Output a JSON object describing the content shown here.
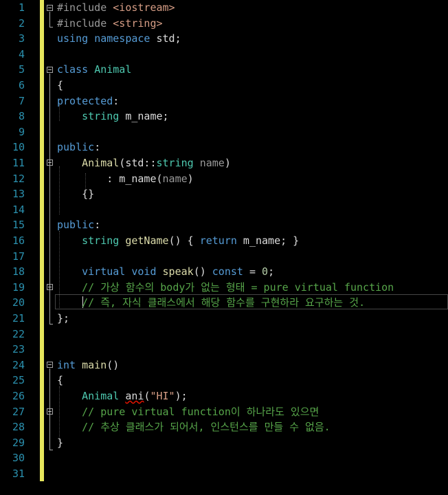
{
  "editor": {
    "line_numbers": [
      "1",
      "2",
      "3",
      "4",
      "5",
      "6",
      "7",
      "8",
      "9",
      "10",
      "11",
      "12",
      "13",
      "14",
      "15",
      "16",
      "17",
      "18",
      "19",
      "20",
      "21",
      "22",
      "23",
      "24",
      "25",
      "26",
      "27",
      "28",
      "29",
      "30",
      "31"
    ],
    "colors": {
      "background": "#000000",
      "line_number": "#2b91af",
      "keyword": "#569cd6",
      "type": "#4ec9b0",
      "function": "#dcdcaa",
      "comment": "#57a64a",
      "string": "#d69d85",
      "change_bar": "#e6e65c"
    },
    "lines": [
      [
        {
          "t": "#include ",
          "c": "pp"
        },
        {
          "t": "<iostream>",
          "c": "inc"
        }
      ],
      [
        {
          "t": "#include ",
          "c": "pp"
        },
        {
          "t": "<string>",
          "c": "inc"
        }
      ],
      [
        {
          "t": "using",
          "c": "kw"
        },
        {
          "t": " ",
          "c": ""
        },
        {
          "t": "namespace",
          "c": "kw"
        },
        {
          "t": " std;",
          "c": ""
        }
      ],
      [],
      [
        {
          "t": "class",
          "c": "kw"
        },
        {
          "t": " ",
          "c": ""
        },
        {
          "t": "Animal",
          "c": "ty"
        }
      ],
      [
        {
          "t": "{",
          "c": ""
        }
      ],
      [
        {
          "t": "protected",
          "c": "kw"
        },
        {
          "t": ":",
          "c": ""
        }
      ],
      [
        {
          "t": "    ",
          "c": ""
        },
        {
          "t": "string",
          "c": "ty"
        },
        {
          "t": " m_name;",
          "c": ""
        }
      ],
      [],
      [
        {
          "t": "public",
          "c": "kw"
        },
        {
          "t": ":",
          "c": ""
        }
      ],
      [
        {
          "t": "    ",
          "c": ""
        },
        {
          "t": "Animal",
          "c": "fn"
        },
        {
          "t": "(std::",
          "c": ""
        },
        {
          "t": "string",
          "c": "ty"
        },
        {
          "t": " ",
          "c": ""
        },
        {
          "t": "name",
          "c": "pm"
        },
        {
          "t": ")",
          "c": ""
        }
      ],
      [
        {
          "t": "        : m_name(",
          "c": ""
        },
        {
          "t": "name",
          "c": "pm"
        },
        {
          "t": ")",
          "c": ""
        }
      ],
      [
        {
          "t": "    {}",
          "c": ""
        }
      ],
      [],
      [
        {
          "t": "public",
          "c": "kw"
        },
        {
          "t": ":",
          "c": ""
        }
      ],
      [
        {
          "t": "    ",
          "c": ""
        },
        {
          "t": "string",
          "c": "ty"
        },
        {
          "t": " ",
          "c": ""
        },
        {
          "t": "getName",
          "c": "fn"
        },
        {
          "t": "() { ",
          "c": ""
        },
        {
          "t": "return",
          "c": "kw"
        },
        {
          "t": " m_name; }",
          "c": ""
        }
      ],
      [],
      [
        {
          "t": "    ",
          "c": ""
        },
        {
          "t": "virtual",
          "c": "kw"
        },
        {
          "t": " ",
          "c": ""
        },
        {
          "t": "void",
          "c": "kw"
        },
        {
          "t": " ",
          "c": ""
        },
        {
          "t": "speak",
          "c": "fn"
        },
        {
          "t": "() ",
          "c": ""
        },
        {
          "t": "const",
          "c": "kw"
        },
        {
          "t": " = ",
          "c": ""
        },
        {
          "t": "0",
          "c": "num"
        },
        {
          "t": ";",
          "c": ""
        }
      ],
      [
        {
          "t": "    ",
          "c": ""
        },
        {
          "t": "// 가상 함수의 body가 없는 형태 = pure virtual function",
          "c": "cm"
        }
      ],
      [
        {
          "t": "    ",
          "c": ""
        },
        {
          "t": "// 즉, 자식 클래스에서 해당 함수를 구현하라 요구하는 것.",
          "c": "cm"
        }
      ],
      [
        {
          "t": "};",
          "c": ""
        }
      ],
      [],
      [],
      [
        {
          "t": "int",
          "c": "kw"
        },
        {
          "t": " ",
          "c": ""
        },
        {
          "t": "main",
          "c": "fn"
        },
        {
          "t": "()",
          "c": ""
        }
      ],
      [
        {
          "t": "{",
          "c": ""
        }
      ],
      [
        {
          "t": "    ",
          "c": ""
        },
        {
          "t": "Animal",
          "c": "ty"
        },
        {
          "t": " ",
          "c": ""
        },
        {
          "t": "ani",
          "c": "sq"
        },
        {
          "t": "(",
          "c": ""
        },
        {
          "t": "\"HI\"",
          "c": "str"
        },
        {
          "t": ");",
          "c": ""
        }
      ],
      [
        {
          "t": "    ",
          "c": ""
        },
        {
          "t": "// pure virtual function이 하나라도 있으면",
          "c": "cm"
        }
      ],
      [
        {
          "t": "    ",
          "c": ""
        },
        {
          "t": "// 추상 클래스가 되어서, 인스턴스를 만들 수 없음.",
          "c": "cm"
        }
      ],
      [
        {
          "t": "}",
          "c": ""
        }
      ],
      [],
      []
    ]
  }
}
